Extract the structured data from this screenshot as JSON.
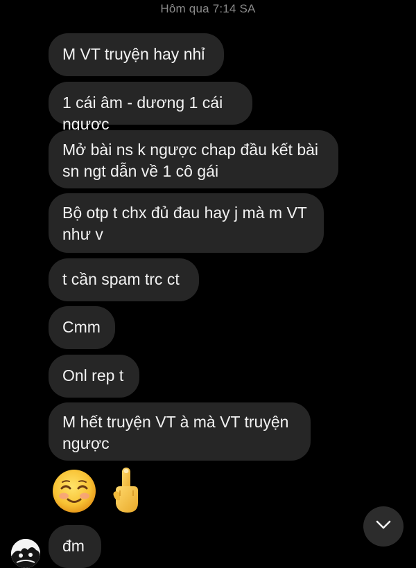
{
  "conversation": {
    "timestamp": "Hôm qua 7:14 SA",
    "messages": [
      "M VT truyện hay nhỉ",
      "1 cái âm - dương 1 cái ngược",
      "Mở bài ns k ngược chap đầu kết bài\nsn ngt dẫn về 1 cô gái",
      "Bộ otp t chx đủ đau hay j mà m VT\nnhư v",
      "t cần spam trc ct",
      "Cmm",
      "Onl rep t",
      "M hết truyện VT à mà VT truyện\nngược",
      "đm"
    ],
    "emoji_message": [
      "smiling-face-emoji",
      "middle-finger-emoji"
    ]
  },
  "controls": {
    "scroll_down_icon": "chevron-down-icon"
  },
  "colors": {
    "background": "#000000",
    "bubble": "#262626",
    "text": "#f2f2f2",
    "timestamp": "#8a8a8a",
    "scroll_button": "#2c2c2c"
  }
}
